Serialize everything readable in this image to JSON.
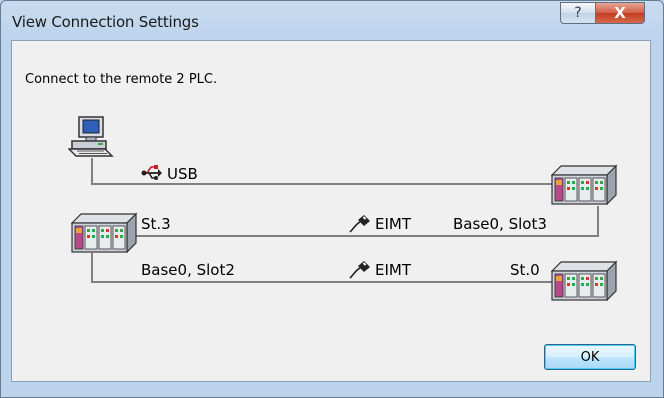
{
  "window": {
    "title": "View Connection Settings",
    "help_label": "?",
    "close_label": "X"
  },
  "message": "Connect to the remote 2 PLC.",
  "connections": [
    {
      "medium": "USB",
      "medium_icon": "usb-icon"
    },
    {
      "start_label": "St.3",
      "medium": "EIMT",
      "medium_icon": "ethernet-cable-icon",
      "end_label": "Base0, Slot3"
    },
    {
      "start_label": "Base0, Slot2",
      "medium": "EIMT",
      "medium_icon": "ethernet-cable-icon",
      "end_label": "St.0"
    }
  ],
  "devices": {
    "pc_icon": "computer-icon",
    "plc_icon": "plc-icon"
  },
  "buttons": {
    "ok_label": "OK"
  },
  "colors": {
    "titlebar": "#bcd3ec",
    "client": "#f0f0f0",
    "close": "#c23c22",
    "link_line": "#808080"
  }
}
